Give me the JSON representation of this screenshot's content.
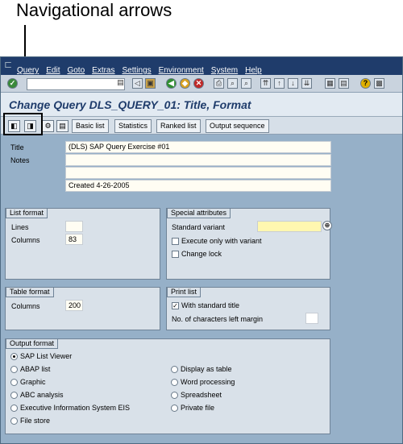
{
  "callout": {
    "text": "Navigational arrows"
  },
  "menu": [
    "Query",
    "Edit",
    "Goto",
    "Extras",
    "Settings",
    "Environment",
    "System",
    "Help"
  ],
  "title": "Change Query DLS_QUERY_01: Title, Format",
  "app_toolbar": {
    "buttons": [
      "Basic list",
      "Statistics",
      "Ranked list",
      "Output sequence"
    ]
  },
  "header": {
    "title_label": "Title",
    "title_value": "(DLS) SAP Query Exercise #01",
    "notes_label": "Notes",
    "notes_line1": "",
    "notes_line2": "",
    "notes_line3": "Created 4-26-2005"
  },
  "list_format": {
    "caption": "List format",
    "lines_label": "Lines",
    "lines_value": "",
    "columns_label": "Columns",
    "columns_value": "83"
  },
  "special_attributes": {
    "caption": "Special attributes",
    "std_variant_label": "Standard variant",
    "std_variant_value": "",
    "execute_only_label": "Execute only with variant",
    "change_lock_label": "Change lock"
  },
  "table_format": {
    "caption": "Table format",
    "columns_label": "Columns",
    "columns_value": "200"
  },
  "print_list": {
    "caption": "Print list",
    "with_title_label": "With standard title",
    "left_margin_label": "No. of characters left margin",
    "left_margin_value": ""
  },
  "output_format": {
    "caption": "Output format",
    "options_left": [
      "SAP List Viewer",
      "ABAP list",
      "Graphic",
      "ABC analysis",
      "Executive Information System EIS",
      "File store"
    ],
    "options_right": [
      "Display as table",
      "Word processing",
      "Spreadsheet",
      "Private file"
    ],
    "selected": "SAP List Viewer"
  }
}
